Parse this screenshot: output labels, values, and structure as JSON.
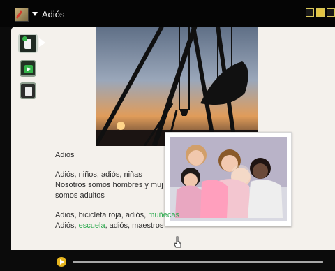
{
  "window": {
    "title": "Adiós",
    "top_controls": [
      "mode-icon-1",
      "mode-icon-2",
      "mode-icon-3"
    ]
  },
  "tools": [
    {
      "name": "book-icon"
    },
    {
      "name": "sound-icon"
    },
    {
      "name": "page-icon"
    }
  ],
  "content": {
    "heading": "Adiós",
    "paragraph1": {
      "line1": "Adiós, niños, adiós, niñas",
      "line2": "Nosotros somos hombres y muj",
      "line3": "somos adultos"
    },
    "paragraph2": {
      "line1_prefix": "Adiós, bicicleta roja, adiós, ",
      "line1_highlight": "muñecas",
      "line2_prefix": "Adiós, ",
      "line2_highlight": "escuela",
      "line2_suffix": ", adiós, maestros"
    }
  },
  "colors": {
    "highlight": "#28a84b",
    "accent": "#e7b61f"
  },
  "progress": {
    "value": 0.0
  }
}
